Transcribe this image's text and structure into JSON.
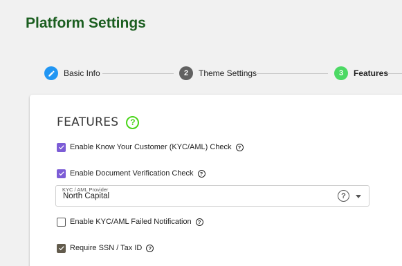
{
  "header": {
    "title": "Platform Settings"
  },
  "stepper": {
    "steps": [
      {
        "number": "",
        "label": "Basic Info",
        "state": "completed",
        "color": "#2196f3",
        "icon": "pencil-icon"
      },
      {
        "number": "2",
        "label": "Theme Settings",
        "state": "inactive",
        "color": "#616161"
      },
      {
        "number": "3",
        "label": "Features",
        "state": "active",
        "color": "#4cd964"
      }
    ]
  },
  "features": {
    "title": "FEATURES",
    "help_icon": "help-circle-icon",
    "accent_color": "#4ad51a",
    "items": [
      {
        "label": "Enable Know Your Customer (KYC/AML) Check",
        "checked": true
      },
      {
        "label": "Enable Document Verification Check",
        "checked": true
      },
      {
        "label": "Enable KYC/AML Failed Notification",
        "checked": false
      },
      {
        "label": "Require SSN / Tax ID",
        "checked": true,
        "highlighted": true
      }
    ],
    "provider_select": {
      "label": "KYC / AML Provider",
      "value": "North Capital"
    }
  }
}
